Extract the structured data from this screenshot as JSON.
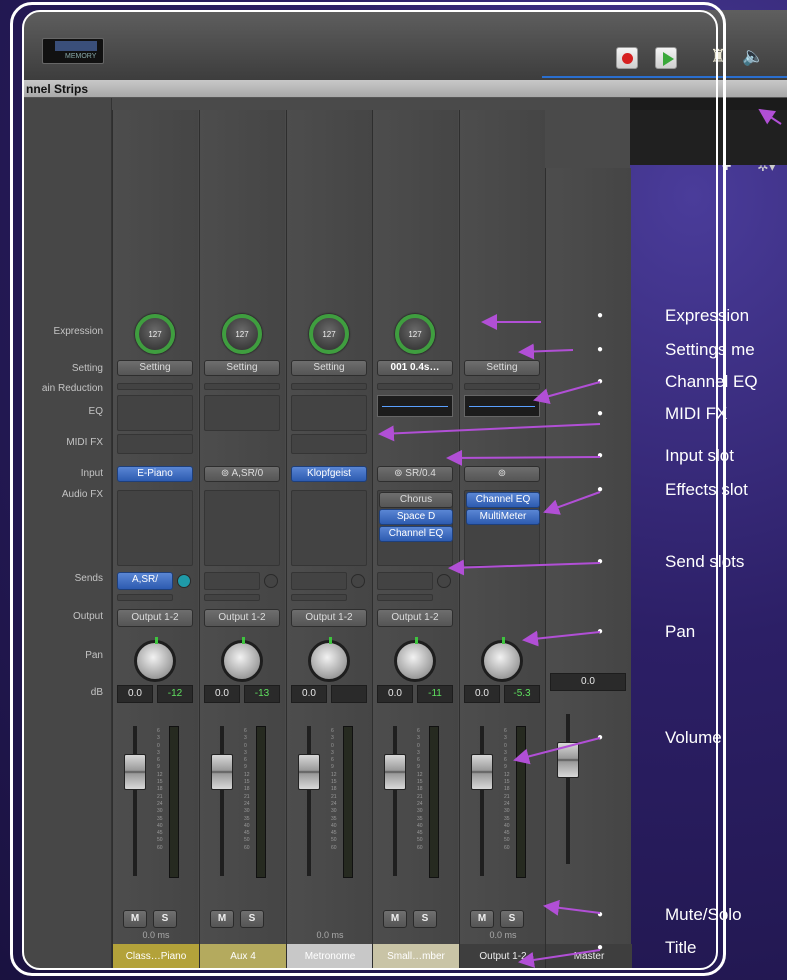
{
  "toolbar": {
    "lcd_label": "MEMORY",
    "record_icon": "record-icon",
    "play_icon": "play-icon",
    "metronome_icon": "metronome-icon",
    "speaker_icon": "speaker-icon"
  },
  "panel": {
    "title": "nnel Strips",
    "add_label": "+",
    "gear_label": "✲▾"
  },
  "row_labels": {
    "expression": "Expression",
    "setting": "Setting",
    "gain_reduction": "ain Reduction",
    "eq": "EQ",
    "midi_fx": "MIDI FX",
    "input": "Input",
    "audio_fx": "Audio FX",
    "sends": "Sends",
    "output": "Output",
    "pan": "Pan",
    "db": "dB"
  },
  "strips": [
    {
      "expression": "127",
      "setting": "Setting",
      "input": "E-Piano",
      "send": "A,SR/",
      "output": "Output 1-2",
      "db_left": "0.0",
      "db_right": "-12",
      "delay": "0.0 ms",
      "mute": "M",
      "solo": "S",
      "name": "Class…Piano",
      "name_color": "#b3a23a"
    },
    {
      "expression": "127",
      "setting": "Setting",
      "input": "A,SR/0",
      "output": "Output 1-2",
      "db_left": "0.0",
      "db_right": "-13",
      "mute": "M",
      "solo": "S",
      "name": "Aux 4",
      "name_color": "#b4aa5e"
    },
    {
      "expression": "127",
      "setting": "Setting",
      "input": "Klopfgeist",
      "output": "Output 1-2",
      "db_left": "0.0",
      "db_right": "",
      "delay": "0.0 ms",
      "name": "Metronome",
      "name_color": "#c8c8c8"
    },
    {
      "expression": "127",
      "setting": "001 0.4s…",
      "input": "SR/0.4",
      "fx": [
        "Chorus",
        "Space D",
        "Channel EQ"
      ],
      "output": "Output 1-2",
      "db_left": "0.0",
      "db_right": "-11",
      "mute": "M",
      "solo": "S",
      "name": "Small…mber",
      "name_color": "#c9c4a6"
    },
    {
      "setting": "Setting",
      "fx": [
        "Channel EQ",
        "MultiMeter"
      ],
      "db_left": "0.0",
      "db_right": "-5.3",
      "delay": "0.0 ms",
      "mute": "M",
      "solo": "S",
      "name": "Output 1-2",
      "name_color": "#3e3e3e"
    },
    {
      "db_left": "0.0",
      "name": "Master",
      "name_color": "#3e3e3e"
    }
  ],
  "fader_scale": [
    "6",
    "3",
    "0",
    "3",
    "6",
    "9",
    "12",
    "15",
    "18",
    "21",
    "24",
    "30",
    "35",
    "40",
    "45",
    "50",
    "60"
  ],
  "annotations": [
    "Expression",
    "Settings me",
    "Channel EQ",
    "MIDI FX",
    "Input slot",
    "Effects slot",
    "Send slots",
    "Pan",
    "Volume",
    "Mute/Solo",
    "Title"
  ],
  "colors": {
    "annotation_arrow": "#b14fd6",
    "accent_green": "#3f9e3f",
    "slot_blue": "#3d6fc4"
  }
}
